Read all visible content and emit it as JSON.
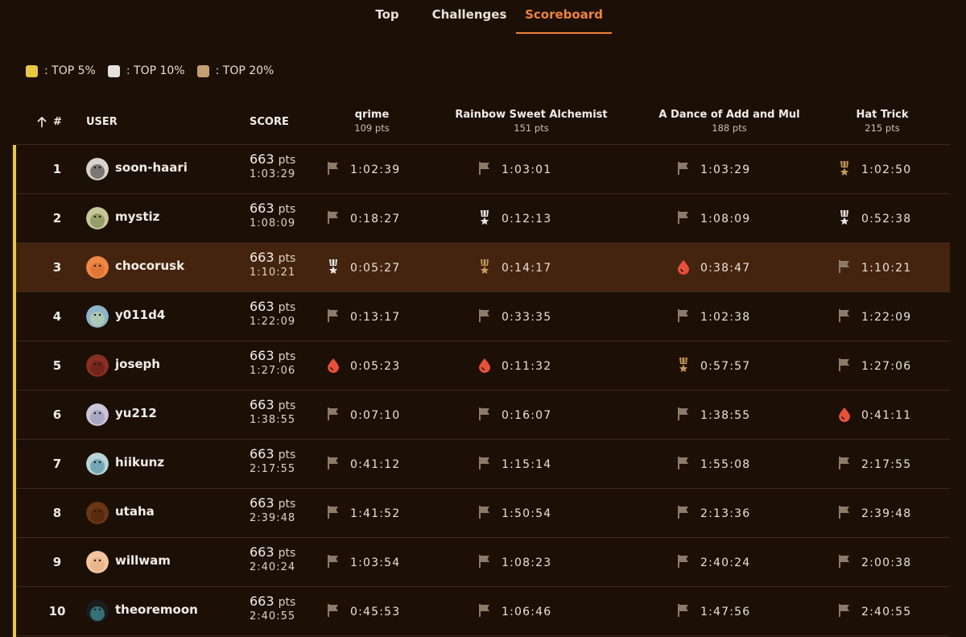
{
  "nav": {
    "tabs": [
      {
        "label": "Top",
        "active": false
      },
      {
        "label": "Challenges",
        "active": false
      },
      {
        "label": "Scoreboard",
        "active": true
      }
    ]
  },
  "legend": [
    {
      "label": ": TOP 5%",
      "color": "#e8c744"
    },
    {
      "label": ": TOP 10%",
      "color": "#e4e2df"
    },
    {
      "label": ": TOP 20%",
      "color": "#c4a070"
    }
  ],
  "table": {
    "headers": {
      "rank": "#",
      "sort_icon": "arrow-up-icon",
      "user": "USER",
      "score": "SCORE"
    },
    "challenges": [
      {
        "name": "qrime",
        "points": "109 pts"
      },
      {
        "name": "Rainbow Sweet Alchemist",
        "points": "151 pts"
      },
      {
        "name": "A Dance of Add and Mul",
        "points": "188 pts"
      },
      {
        "name": "Hat Trick",
        "points": "215 pts"
      }
    ],
    "score_unit": "pts",
    "rows": [
      {
        "rank": "1",
        "user": "soon-haari",
        "score": "663",
        "time": "1:03:29",
        "highlight": false,
        "solves": [
          {
            "icon": "flag-icon",
            "time": "1:02:39"
          },
          {
            "icon": "flag-icon",
            "time": "1:03:01"
          },
          {
            "icon": "flag-icon",
            "time": "1:03:29"
          },
          {
            "icon": "bronze-medal-icon",
            "time": "1:02:50"
          }
        ]
      },
      {
        "rank": "2",
        "user": "mystiz",
        "score": "663",
        "time": "1:08:09",
        "highlight": false,
        "solves": [
          {
            "icon": "flag-icon",
            "time": "0:18:27"
          },
          {
            "icon": "silver-medal-icon",
            "time": "0:12:13"
          },
          {
            "icon": "flag-icon",
            "time": "1:08:09"
          },
          {
            "icon": "silver-medal-icon",
            "time": "0:52:38"
          }
        ]
      },
      {
        "rank": "3",
        "user": "chocorusk",
        "score": "663",
        "time": "1:10:21",
        "highlight": true,
        "solves": [
          {
            "icon": "silver-medal-icon",
            "time": "0:05:27"
          },
          {
            "icon": "bronze-medal-icon",
            "time": "0:14:17"
          },
          {
            "icon": "first-blood-icon",
            "time": "0:38:47"
          },
          {
            "icon": "flag-icon",
            "time": "1:10:21"
          }
        ]
      },
      {
        "rank": "4",
        "user": "y011d4",
        "score": "663",
        "time": "1:22:09",
        "highlight": false,
        "solves": [
          {
            "icon": "flag-icon",
            "time": "0:13:17"
          },
          {
            "icon": "flag-icon",
            "time": "0:33:35"
          },
          {
            "icon": "flag-icon",
            "time": "1:02:38"
          },
          {
            "icon": "flag-icon",
            "time": "1:22:09"
          }
        ]
      },
      {
        "rank": "5",
        "user": "joseph",
        "score": "663",
        "time": "1:27:06",
        "highlight": false,
        "solves": [
          {
            "icon": "first-blood-icon",
            "time": "0:05:23"
          },
          {
            "icon": "first-blood-icon",
            "time": "0:11:32"
          },
          {
            "icon": "bronze-medal-icon",
            "time": "0:57:57"
          },
          {
            "icon": "flag-icon",
            "time": "1:27:06"
          }
        ]
      },
      {
        "rank": "6",
        "user": "yu212",
        "score": "663",
        "time": "1:38:55",
        "highlight": false,
        "solves": [
          {
            "icon": "flag-icon",
            "time": "0:07:10"
          },
          {
            "icon": "flag-icon",
            "time": "0:16:07"
          },
          {
            "icon": "flag-icon",
            "time": "1:38:55"
          },
          {
            "icon": "first-blood-icon",
            "time": "0:41:11"
          }
        ]
      },
      {
        "rank": "7",
        "user": "hiikunz",
        "score": "663",
        "time": "2:17:55",
        "highlight": false,
        "solves": [
          {
            "icon": "flag-icon",
            "time": "0:41:12"
          },
          {
            "icon": "flag-icon",
            "time": "1:15:14"
          },
          {
            "icon": "flag-icon",
            "time": "1:55:08"
          },
          {
            "icon": "flag-icon",
            "time": "2:17:55"
          }
        ]
      },
      {
        "rank": "8",
        "user": "utaha",
        "score": "663",
        "time": "2:39:48",
        "highlight": false,
        "solves": [
          {
            "icon": "flag-icon",
            "time": "1:41:52"
          },
          {
            "icon": "flag-icon",
            "time": "1:50:54"
          },
          {
            "icon": "flag-icon",
            "time": "2:13:36"
          },
          {
            "icon": "flag-icon",
            "time": "2:39:48"
          }
        ]
      },
      {
        "rank": "9",
        "user": "willwam",
        "score": "663",
        "time": "2:40:24",
        "highlight": false,
        "solves": [
          {
            "icon": "flag-icon",
            "time": "1:03:54"
          },
          {
            "icon": "flag-icon",
            "time": "1:08:23"
          },
          {
            "icon": "flag-icon",
            "time": "2:40:24"
          },
          {
            "icon": "flag-icon",
            "time": "2:00:38"
          }
        ]
      },
      {
        "rank": "10",
        "user": "theoremoon",
        "score": "663",
        "time": "2:40:55",
        "highlight": false,
        "solves": [
          {
            "icon": "flag-icon",
            "time": "0:45:53"
          },
          {
            "icon": "flag-icon",
            "time": "1:06:46"
          },
          {
            "icon": "flag-icon",
            "time": "1:47:56"
          },
          {
            "icon": "flag-icon",
            "time": "2:40:55"
          }
        ]
      }
    ]
  }
}
